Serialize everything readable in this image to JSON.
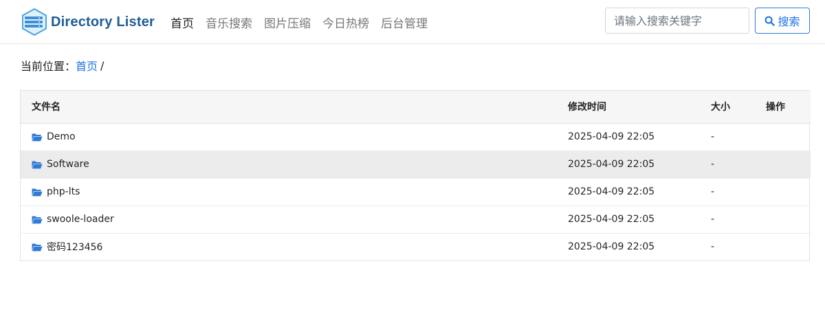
{
  "brand": {
    "name": "Directory Lister"
  },
  "nav": {
    "items": [
      {
        "label": "首页",
        "active": true
      },
      {
        "label": "音乐搜索",
        "active": false
      },
      {
        "label": "图片压缩",
        "active": false
      },
      {
        "label": "今日热榜",
        "active": false
      },
      {
        "label": "后台管理",
        "active": false
      }
    ]
  },
  "search": {
    "placeholder": "请输入搜索关键字",
    "value": "",
    "button_label": "搜索"
  },
  "breadcrumb": {
    "prefix": "当前位置：",
    "home": "首页",
    "separator": "/"
  },
  "table": {
    "headers": [
      "文件名",
      "修改时间",
      "大小",
      "操作"
    ],
    "rows": [
      {
        "name": "Demo",
        "modified": "2025-04-09 22:05",
        "size": "-",
        "icon": "folder-open-icon"
      },
      {
        "name": "Software",
        "modified": "2025-04-09 22:05",
        "size": "-",
        "icon": "folder-open-icon",
        "highlighted": true
      },
      {
        "name": "php-lts",
        "modified": "2025-04-09 22:05",
        "size": "-",
        "icon": "folder-open-icon"
      },
      {
        "name": "swoole-loader",
        "modified": "2025-04-09 22:05",
        "size": "-",
        "icon": "folder-open-icon"
      },
      {
        "name": "密码123456",
        "modified": "2025-04-09 22:05",
        "size": "-",
        "icon": "folder-open-icon"
      }
    ]
  },
  "colors": {
    "brand": "#1f5b96",
    "link": "#1a73e8",
    "folder": "#2f7bd6",
    "row_hover": "#ececec",
    "header_bg": "#f6f6f6"
  }
}
